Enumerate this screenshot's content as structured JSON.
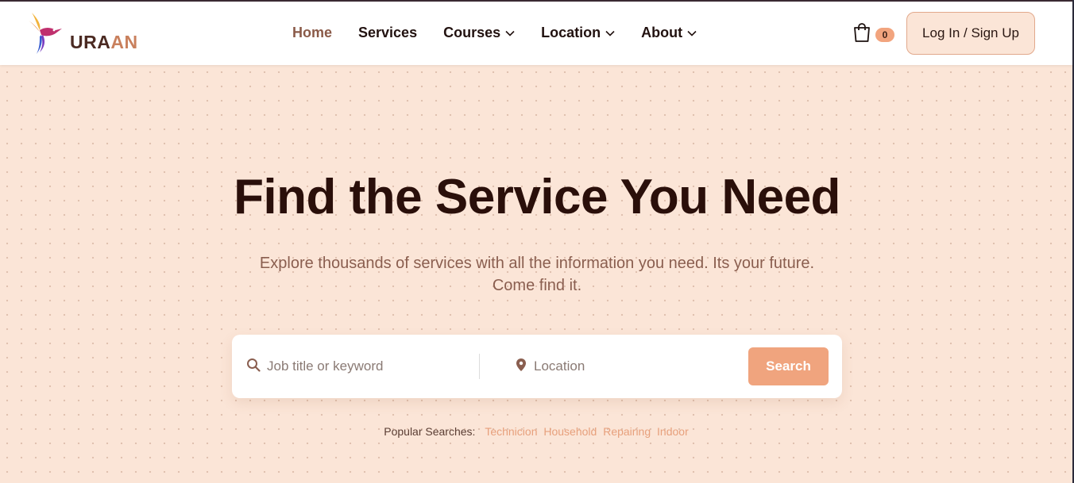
{
  "brand": {
    "name_part1": "URA",
    "name_part2": "AN"
  },
  "nav": {
    "items": [
      {
        "label": "Home",
        "active": true,
        "dropdown": false
      },
      {
        "label": "Services",
        "active": false,
        "dropdown": false
      },
      {
        "label": "Courses",
        "active": false,
        "dropdown": true
      },
      {
        "label": "Location",
        "active": false,
        "dropdown": true
      },
      {
        "label": "About",
        "active": false,
        "dropdown": true
      }
    ]
  },
  "cart": {
    "count": "0",
    "icon": "shopping-bag-icon"
  },
  "auth": {
    "login_label": "Log In / Sign Up"
  },
  "hero": {
    "title": "Find the Service You Need",
    "subtitle_line1": "Explore thousands of services with all the information you need. Its your future.",
    "subtitle_line2": "Come find it."
  },
  "search": {
    "keyword_placeholder": "Job title or keyword",
    "keyword_value": "",
    "location_placeholder": "Location",
    "location_value": "",
    "button_label": "Search"
  },
  "popular": {
    "label": "Popular Searches:",
    "tags": [
      "Technicion",
      "Household",
      "Repairing",
      "Indoor"
    ]
  },
  "colors": {
    "background": "#fbe5d7",
    "accent": "#f0a47e",
    "heading": "#2a0f0a",
    "nav_active": "#8a5a48"
  }
}
